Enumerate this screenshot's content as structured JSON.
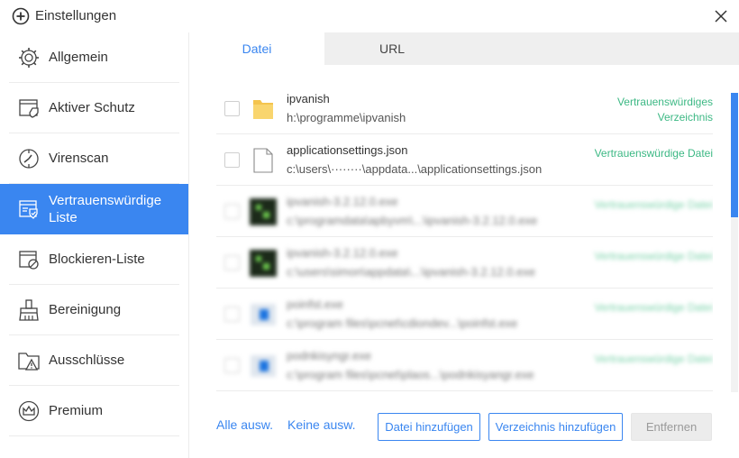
{
  "window": {
    "title": "Einstellungen",
    "title_icon": "plus-circle-icon",
    "close_icon": "close-icon"
  },
  "sidebar": {
    "items": [
      {
        "label": "Allgemein",
        "icon": "gear-icon"
      },
      {
        "label": "Aktiver Schutz",
        "icon": "shield-window-icon"
      },
      {
        "label": "Virenscan",
        "icon": "scan-icon"
      },
      {
        "label": "Vertrauenswürdige Liste",
        "icon": "trusted-list-icon",
        "active": true
      },
      {
        "label": "Blockieren-Liste",
        "icon": "block-list-icon"
      },
      {
        "label": "Bereinigung",
        "icon": "broom-icon"
      },
      {
        "label": "Ausschlüsse",
        "icon": "folder-warning-icon"
      },
      {
        "label": "Premium",
        "icon": "crown-icon"
      }
    ]
  },
  "tabs": [
    {
      "label": "Datei",
      "active": true
    },
    {
      "label": "URL",
      "active": false
    }
  ],
  "files": [
    {
      "name": "ipvanish",
      "path": "h:\\programme\\ipvanish",
      "type": "Vertrauenswürdiges Verzeichnis",
      "icon": "folder-icon"
    },
    {
      "name": "applicationsettings.json",
      "path": "c:\\users\\········\\appdata...\\applicationsettings.json",
      "type": "Vertrauenswürdige Datei",
      "icon": "document-icon"
    },
    {
      "name": "ipvanish-3.2.12.0.exe",
      "path": "c:\\programdata\\apbyvm\\...\\ipvanish-3.2.12.0.exe",
      "type": "Vertrauenswürdige Datei",
      "icon": "ipvanish-app-icon"
    },
    {
      "name": "ipvanish-3.2.12.0.exe",
      "path": "c:\\users\\simon\\appdata\\...\\ipvanish-3.2.12.0.exe",
      "type": "Vertrauenswürdige Datei",
      "icon": "ipvanish-app-icon"
    },
    {
      "name": "poinfst.exe",
      "path": "c:\\program files\\pcnet\\cdiondev...\\poinfst.exe",
      "type": "Vertrauenswürdige Datei",
      "icon": "blue-app-icon"
    },
    {
      "name": "podnkisyngr.exe",
      "path": "c:\\program files\\pcnet\\plaos...\\podnkisyangr.exe",
      "type": "Vertrauenswürdige Datei",
      "icon": "blue-app-icon"
    }
  ],
  "actions": {
    "select_all": "Alle ausw.",
    "select_none": "Keine ausw.",
    "add_file": "Datei hinzufügen",
    "add_directory": "Verzeichnis hinzufügen",
    "remove": "Entfernen"
  },
  "colors": {
    "accent": "#3a86f0",
    "trusted_text": "#3cb884",
    "disabled_bg": "#ececec"
  }
}
